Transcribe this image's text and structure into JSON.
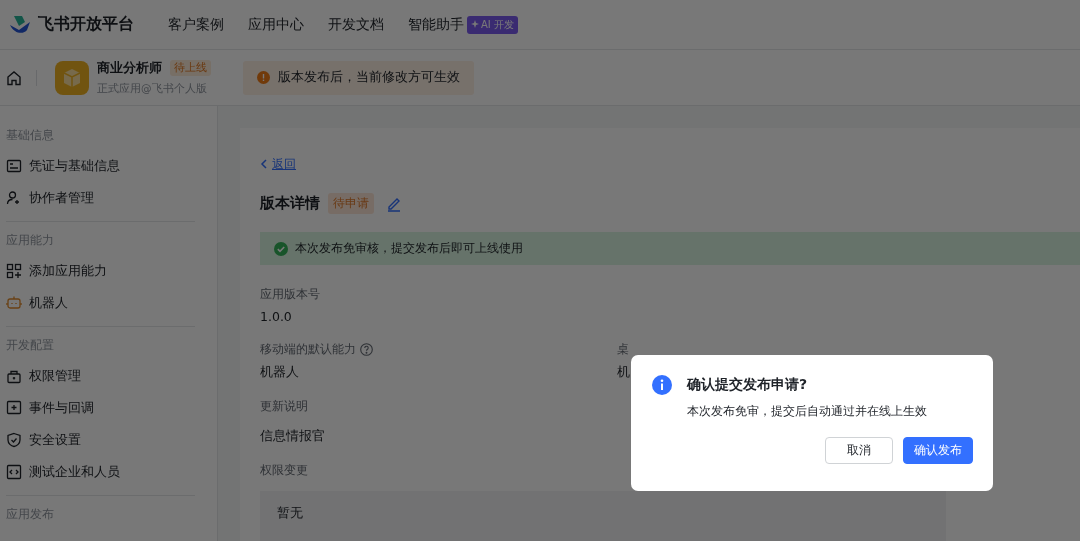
{
  "header": {
    "brand": "飞书开放平台",
    "nav": [
      {
        "label": "客户案例"
      },
      {
        "label": "应用中心"
      },
      {
        "label": "开发文档"
      },
      {
        "label": "智能助手",
        "badge": "AI 开发"
      }
    ]
  },
  "app_bar": {
    "app_name": "商业分析师",
    "status": "待上线",
    "subtitle": "正式应用@飞书个人版",
    "notice": "版本发布后，当前修改方可生效"
  },
  "sidebar": {
    "sections": [
      {
        "title": "基础信息",
        "items": [
          {
            "label": "凭证与基础信息"
          },
          {
            "label": "协作者管理"
          }
        ]
      },
      {
        "title": "应用能力",
        "items": [
          {
            "label": "添加应用能力"
          },
          {
            "label": "机器人"
          }
        ]
      },
      {
        "title": "开发配置",
        "items": [
          {
            "label": "权限管理"
          },
          {
            "label": "事件与回调"
          },
          {
            "label": "安全设置"
          },
          {
            "label": "测试企业和人员"
          }
        ]
      },
      {
        "title": "应用发布"
      }
    ]
  },
  "detail": {
    "back": "返回",
    "title": "版本详情",
    "status": "待申请",
    "alert": "本次发布免审核，提交发布后即可上线使用",
    "fields": [
      {
        "label": "应用版本号",
        "value": "1.0.0"
      },
      {
        "label": "移动端的默认能力",
        "value": "机器人",
        "help": true,
        "side_label": "桌",
        "side_value": "机"
      },
      {
        "label": "更新说明",
        "value": "信息情报官"
      },
      {
        "label": "权限变更",
        "box": "暂无"
      }
    ]
  },
  "dialog": {
    "title": "确认提交发布申请?",
    "message": "本次发布免审，提交后自动通过并在线上生效",
    "buttons": [
      {
        "label": "取消",
        "kind": "secondary"
      },
      {
        "label": "确认发布",
        "kind": "primary"
      }
    ]
  }
}
